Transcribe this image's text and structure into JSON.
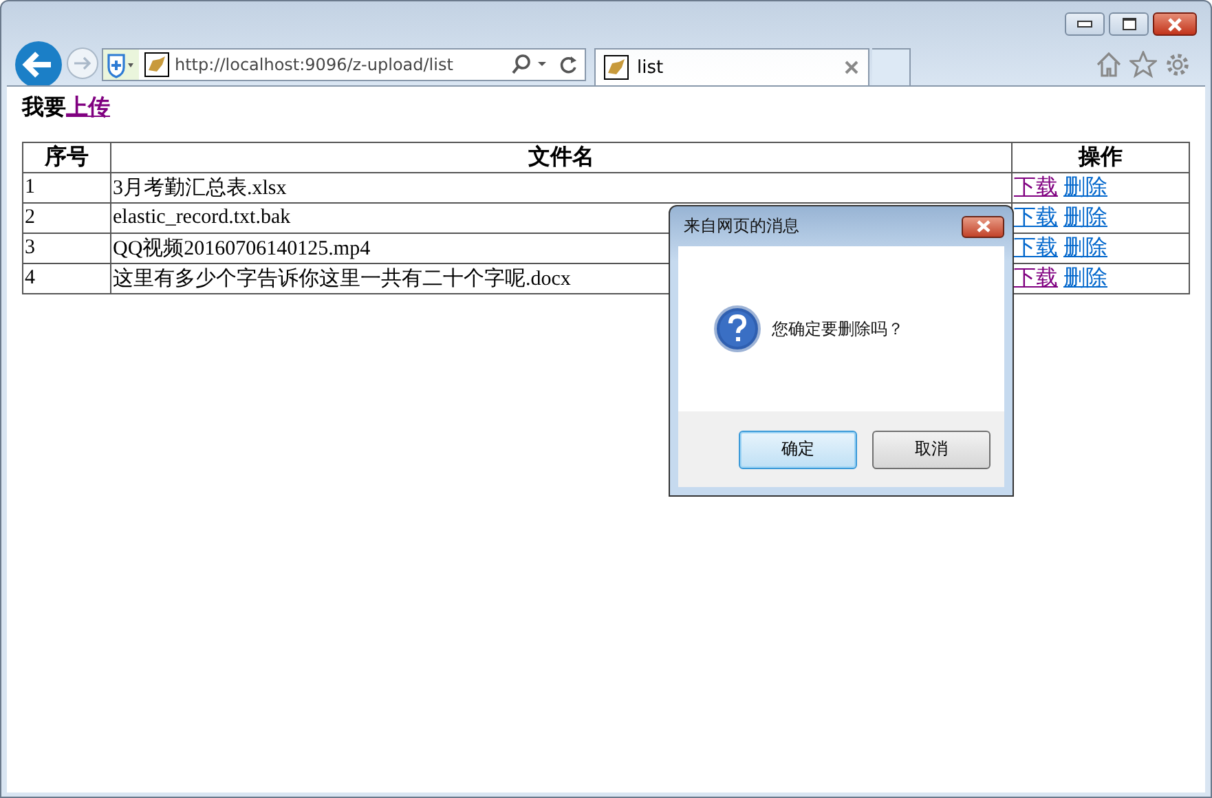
{
  "browser": {
    "url": "http://localhost:9096/z-upload/list",
    "tab": {
      "title": "list",
      "selected": true
    }
  },
  "page": {
    "heading": {
      "text": "我要",
      "link": {
        "text": "上传",
        "visited": true
      }
    },
    "table": {
      "columns": [
        "序号",
        "文件名",
        "操作"
      ],
      "rows": [
        {
          "index": "1",
          "name": "3月考勤汇总表.xlsx",
          "actions": [
            {
              "text": "下载",
              "visited": true
            },
            {
              "text": "删除",
              "visited": false
            }
          ]
        },
        {
          "index": "2",
          "name": "elastic_record.txt.bak",
          "actions": [
            {
              "text": "下载",
              "visited": false
            },
            {
              "text": "删除",
              "visited": false
            }
          ]
        },
        {
          "index": "3",
          "name": "QQ视频20160706140125.mp4",
          "actions": [
            {
              "text": "下载",
              "visited": false
            },
            {
              "text": "删除",
              "visited": false
            }
          ]
        },
        {
          "index": "4",
          "name": "这里有多少个字告诉你这里一共有二十个字呢.docx",
          "actions": [
            {
              "text": "下载",
              "visited": true
            },
            {
              "text": "删除",
              "visited": false
            }
          ]
        }
      ]
    }
  },
  "dialog": {
    "title": "来自网页的消息",
    "message": "您确定要删除吗？",
    "buttons": [
      {
        "label": "确定",
        "selected": true
      },
      {
        "label": "取消",
        "selected": false
      }
    ]
  }
}
